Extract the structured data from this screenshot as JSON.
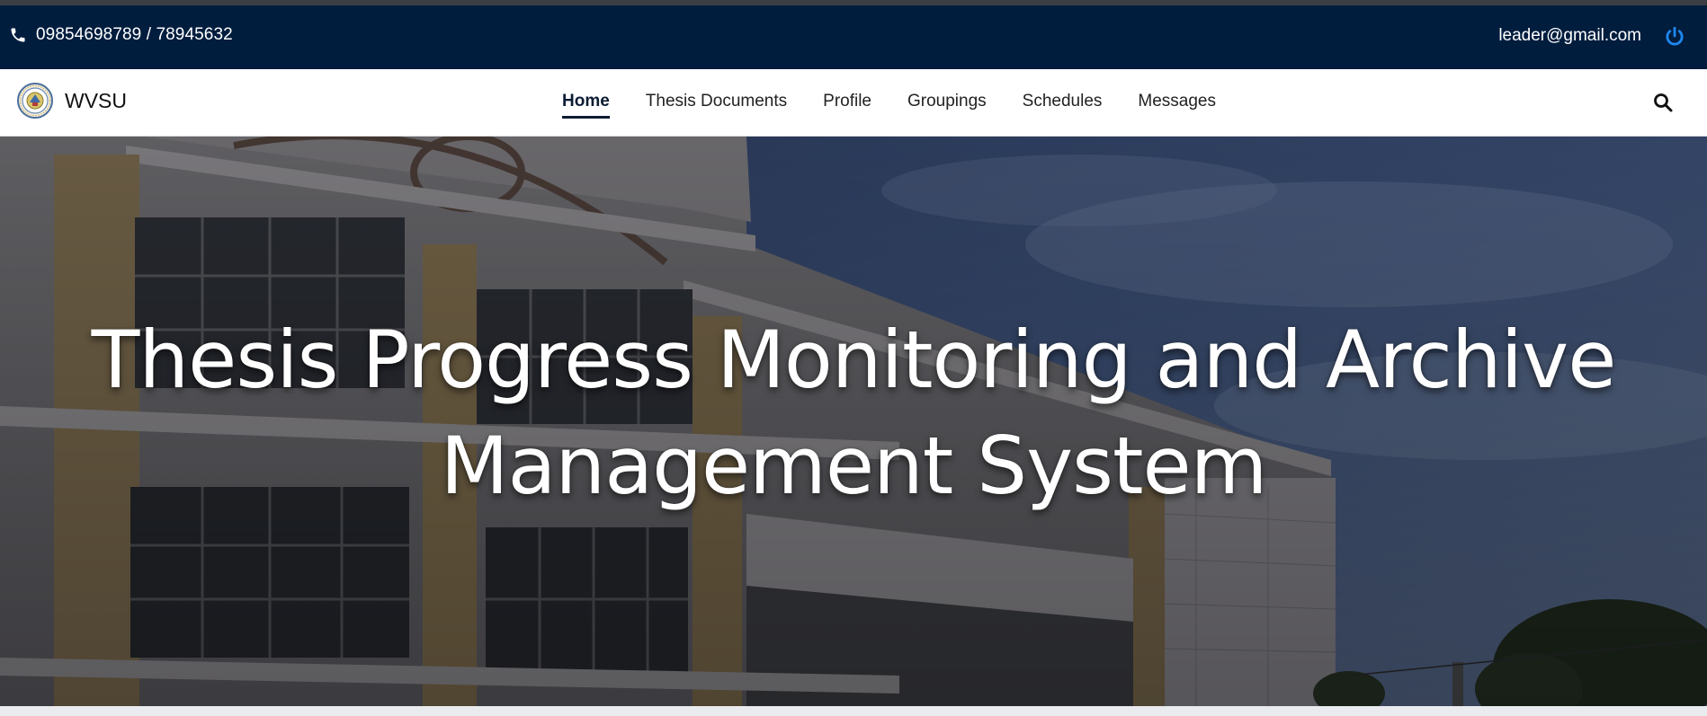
{
  "topbar": {
    "phone_icon": "phone-icon",
    "phone_text": "09854698789 / 78945632",
    "email": "leader@gmail.com",
    "power_icon": "power-icon",
    "background": "#011d3e",
    "power_color": "#1e88f0"
  },
  "navbar": {
    "brand_logo": "university-seal-logo",
    "brand_name": "WVSU",
    "links": [
      {
        "label": "Home",
        "active": true
      },
      {
        "label": "Thesis Documents",
        "active": false
      },
      {
        "label": "Profile",
        "active": false
      },
      {
        "label": "Groupings",
        "active": false
      },
      {
        "label": "Schedules",
        "active": false
      },
      {
        "label": "Messages",
        "active": false
      }
    ],
    "search_icon": "search-icon"
  },
  "hero": {
    "title_line1": "Thesis Progress Monitoring and Archive",
    "title_line2": "Management System",
    "background_image": "university-building-photo"
  }
}
